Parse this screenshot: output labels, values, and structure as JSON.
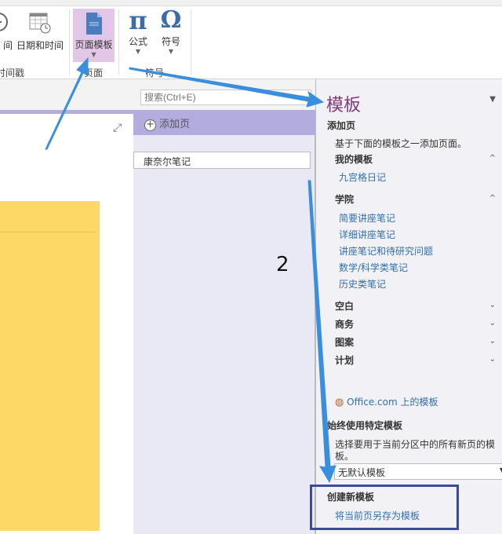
{
  "ribbon": {
    "items": [
      {
        "label": "间",
        "icon": "clock-icon"
      },
      {
        "label": "日期和时间",
        "icon": "calendar-clock-icon"
      },
      {
        "label": "页面模板",
        "icon": "page-template-icon"
      },
      {
        "label": "公式",
        "icon": "pi-icon",
        "glyph": "π"
      },
      {
        "label": "符号",
        "icon": "omega-icon",
        "glyph": "Ω"
      }
    ],
    "groups": [
      "时间戳",
      "页面",
      "符号"
    ],
    "group_partial": "间戳"
  },
  "search": {
    "placeholder": "搜索(Ctrl+E)"
  },
  "pages": {
    "add_label": "添加页",
    "items": [
      "康奈尔笔记"
    ]
  },
  "panel": {
    "title": "模板",
    "add_page": "添加页",
    "desc": "基于下面的模板之一添加页面。",
    "sections": [
      {
        "title": "我的模板",
        "items": [
          "九宫格日记"
        ]
      },
      {
        "title": "学院",
        "items": [
          "简要讲座笔记",
          "详细讲座笔记",
          "讲座笔记和待研究问题",
          "数学/科学类笔记",
          "历史类笔记"
        ]
      },
      {
        "title": "空白",
        "items": []
      },
      {
        "title": "商务",
        "items": []
      },
      {
        "title": "图案",
        "items": []
      },
      {
        "title": "计划",
        "items": []
      }
    ],
    "office_link": "Office.com 上的模板",
    "always_title": "始终使用特定模板",
    "always_title_visible": "始终使用特定模板",
    "always_desc1": "选择要用于当前分区中的所有新页的模",
    "always_desc2": "板。",
    "default_select": "无默认模板",
    "create_title": "创建新模板",
    "save_link": "将当前页另存为模板"
  },
  "annotation": {
    "step": "2",
    "arrow_color": "#3a8ede",
    "box_color": "#3a4b9a"
  },
  "colors": {
    "accent": "#b3addf",
    "title": "#80397b",
    "link": "#2f6fb0",
    "note_yellow": "#fdd866"
  }
}
